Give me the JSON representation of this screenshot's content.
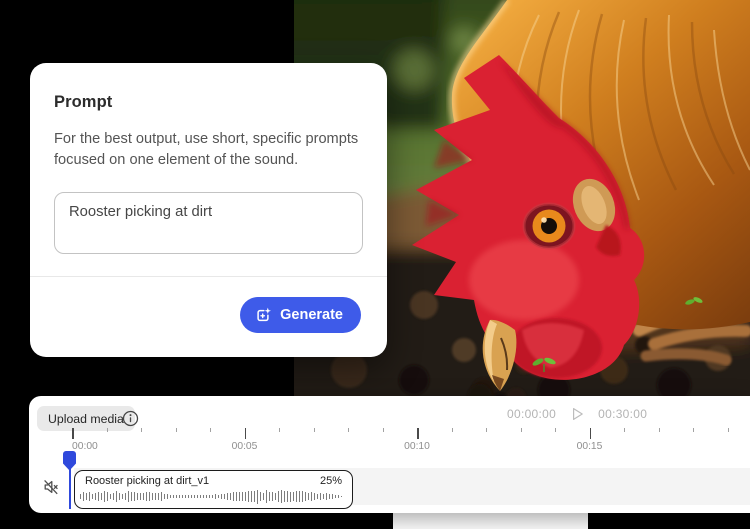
{
  "prompt_card": {
    "title": "Prompt",
    "description": "For the best output, use short, specific prompts focused on one element of the sound.",
    "prompt_value": "Rooster picking at dirt",
    "generate_label": "Generate"
  },
  "timeline": {
    "upload_button_label": "Upload media",
    "current_time": "00:00:00",
    "duration": "00:30:00",
    "ruler_labels": [
      "00:00",
      "00:05",
      "00:10",
      "00:15"
    ],
    "clip": {
      "title": "Rooster picking at dirt_v1",
      "volume": "25%",
      "waveform_envelope": [
        0.55,
        0.7,
        0.5,
        0.65,
        0.8,
        0.6,
        0.75,
        0.55,
        0.7,
        0.6,
        0.5,
        0.62,
        0.45,
        0.55,
        0.4,
        0.25,
        0.2,
        0.3,
        0.25,
        0.2,
        0.3,
        0.25,
        0.35,
        0.3,
        0.45,
        0.7,
        0.85,
        0.75,
        0.9,
        0.8,
        0.95,
        0.85,
        0.9,
        0.8,
        0.85,
        0.75,
        0.8,
        0.7,
        0.75,
        0.6,
        0.5,
        0.4,
        0.3,
        0.2,
        0.1
      ]
    }
  },
  "icons": {
    "generate": "generate-sparkle-icon",
    "info": "info-icon",
    "play": "play-icon",
    "mute": "muted-speaker-icon",
    "playhead": "playhead-marker"
  },
  "colors": {
    "accent_blue": "#3E5BE9",
    "playhead_blue": "#2F49DC"
  }
}
